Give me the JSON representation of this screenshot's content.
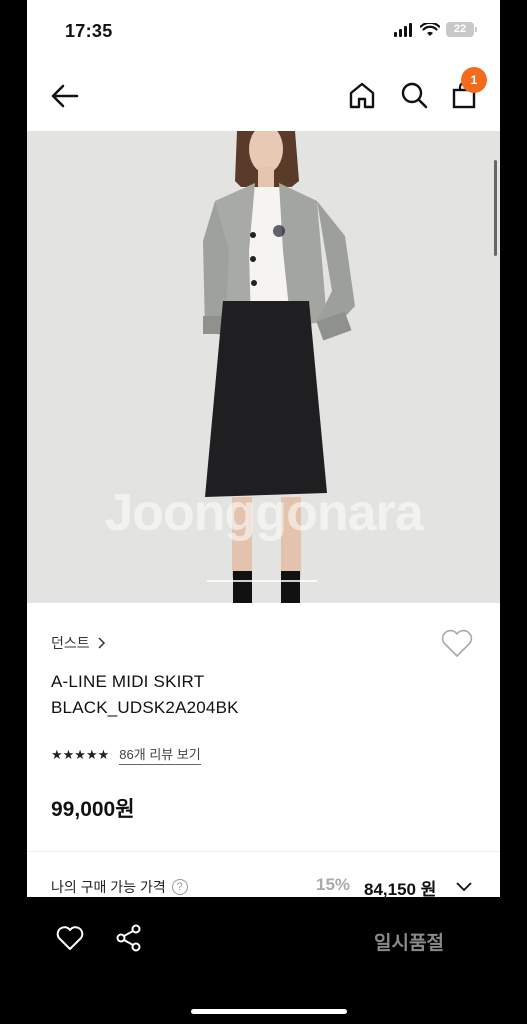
{
  "status_bar": {
    "time": "17:35",
    "battery": "22"
  },
  "header": {
    "cart_count": "1"
  },
  "hero": {
    "watermark": "Joonggonara"
  },
  "product": {
    "brand": "던스트",
    "name_line1": "A-LINE MIDI SKIRT",
    "name_line2": "BLACK_UDSK2A204BK",
    "stars": "★★★★★",
    "review_link": "86개 리뷰 보기",
    "price": "99,000원"
  },
  "member_price": {
    "label": "나의 구매 가능 가격",
    "help": "?",
    "discount": "15%",
    "price": "84,150 원"
  },
  "bottom_bar": {
    "soldout_label": "일시품절"
  },
  "colors": {
    "accent": "#f36b1c",
    "hero_bg": "#e3e3e1"
  }
}
